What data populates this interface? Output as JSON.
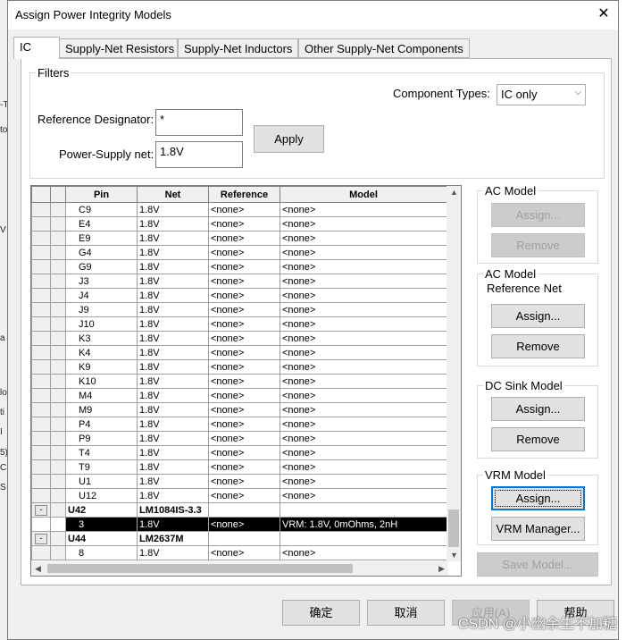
{
  "dialog": {
    "title": "Assign Power Integrity Models",
    "close_icon": "✕"
  },
  "tabs": [
    "IC",
    "Supply-Net Resistors",
    "Supply-Net Inductors",
    "Other Supply-Net Components"
  ],
  "filters": {
    "legend": "Filters",
    "component_types_label": "Component Types:",
    "component_types_value": "IC only",
    "ref_des_label": "Reference Designator:",
    "ref_des_value": "*",
    "power_net_label": "Power-Supply net:",
    "power_net_value": "1.8V",
    "apply": "Apply"
  },
  "table": {
    "headers": [
      "Pin",
      "Net",
      "Reference",
      "Model"
    ],
    "rows": [
      {
        "pin": "C9",
        "net": "1.8V",
        "ref": "<none>",
        "model": "<none>"
      },
      {
        "pin": "E4",
        "net": "1.8V",
        "ref": "<none>",
        "model": "<none>"
      },
      {
        "pin": "E9",
        "net": "1.8V",
        "ref": "<none>",
        "model": "<none>"
      },
      {
        "pin": "G4",
        "net": "1.8V",
        "ref": "<none>",
        "model": "<none>"
      },
      {
        "pin": "G9",
        "net": "1.8V",
        "ref": "<none>",
        "model": "<none>"
      },
      {
        "pin": "J3",
        "net": "1.8V",
        "ref": "<none>",
        "model": "<none>"
      },
      {
        "pin": "J4",
        "net": "1.8V",
        "ref": "<none>",
        "model": "<none>"
      },
      {
        "pin": "J9",
        "net": "1.8V",
        "ref": "<none>",
        "model": "<none>"
      },
      {
        "pin": "J10",
        "net": "1.8V",
        "ref": "<none>",
        "model": "<none>"
      },
      {
        "pin": "K3",
        "net": "1.8V",
        "ref": "<none>",
        "model": "<none>"
      },
      {
        "pin": "K4",
        "net": "1.8V",
        "ref": "<none>",
        "model": "<none>"
      },
      {
        "pin": "K9",
        "net": "1.8V",
        "ref": "<none>",
        "model": "<none>"
      },
      {
        "pin": "K10",
        "net": "1.8V",
        "ref": "<none>",
        "model": "<none>"
      },
      {
        "pin": "M4",
        "net": "1.8V",
        "ref": "<none>",
        "model": "<none>"
      },
      {
        "pin": "M9",
        "net": "1.8V",
        "ref": "<none>",
        "model": "<none>"
      },
      {
        "pin": "P4",
        "net": "1.8V",
        "ref": "<none>",
        "model": "<none>"
      },
      {
        "pin": "P9",
        "net": "1.8V",
        "ref": "<none>",
        "model": "<none>"
      },
      {
        "pin": "T4",
        "net": "1.8V",
        "ref": "<none>",
        "model": "<none>"
      },
      {
        "pin": "T9",
        "net": "1.8V",
        "ref": "<none>",
        "model": "<none>"
      },
      {
        "pin": "U1",
        "net": "1.8V",
        "ref": "<none>",
        "model": "<none>"
      },
      {
        "pin": "U12",
        "net": "1.8V",
        "ref": "<none>",
        "model": "<none>"
      }
    ],
    "comp1": {
      "expander": "-",
      "pin": "U42",
      "net": "LM1084IS-3.3"
    },
    "selected_row": {
      "pin": "3",
      "net": "1.8V",
      "ref": "<none>",
      "model": "VRM: 1.8V, 0mOhms, 2nH"
    },
    "comp2": {
      "expander": "-",
      "pin": "U44",
      "net": "LM2637M"
    },
    "last_row": {
      "pin": "8",
      "net": "1.8V",
      "ref": "<none>",
      "model": "<none>"
    }
  },
  "ac_model": {
    "legend": "AC Model",
    "assign": "Assign...",
    "remove": "Remove"
  },
  "ac_ref_net": {
    "legend": "AC Model",
    "sublabel": "Reference Net",
    "assign": "Assign...",
    "remove": "Remove"
  },
  "dc_sink": {
    "legend": "DC Sink Model",
    "assign": "Assign...",
    "remove": "Remove"
  },
  "vrm": {
    "legend": "VRM Model",
    "assign": "Assign...",
    "manager": "VRM Manager..."
  },
  "save_model": "Save Model...",
  "footer": {
    "ok": "确定",
    "cancel": "取消",
    "apply": "应用(A)",
    "help": "帮助"
  },
  "watermark": "CSDN @小幽余生不加糖",
  "background_marks": [
    "-T",
    "to",
    "V",
    "a",
    "lo",
    "ti",
    "I",
    "5)",
    "CS",
    "S"
  ]
}
